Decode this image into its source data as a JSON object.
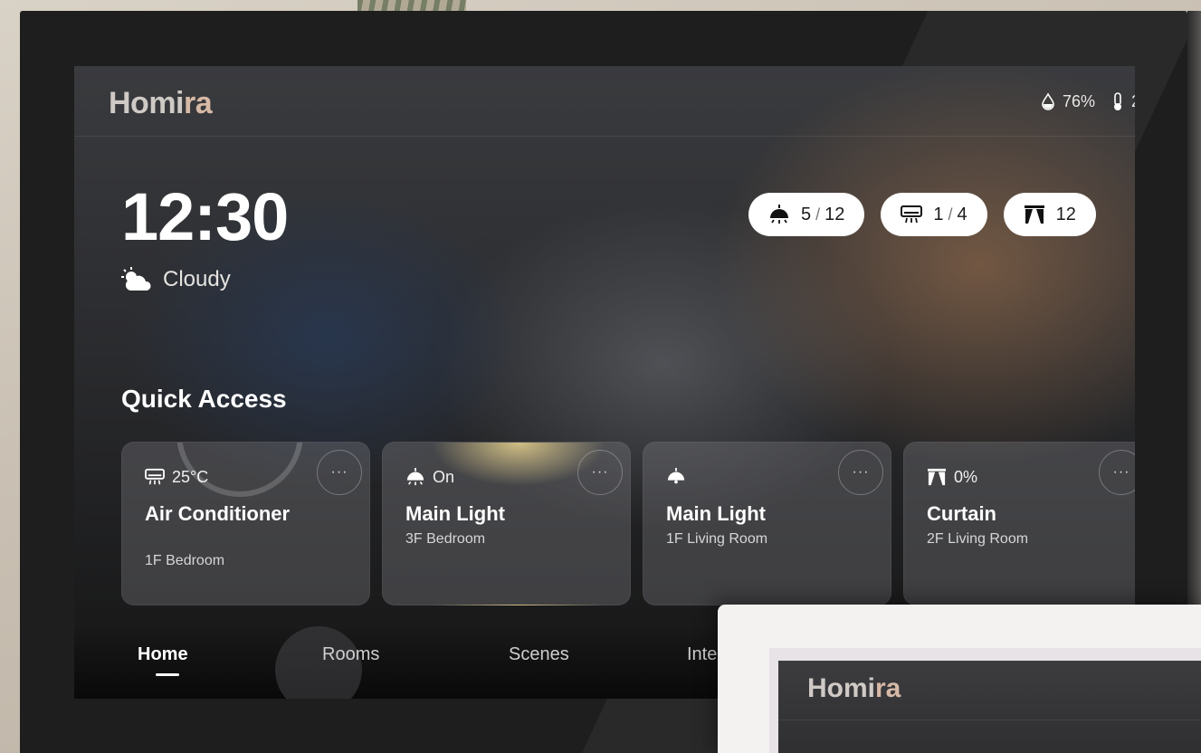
{
  "app": {
    "brand_main": "Homi",
    "brand_accent": "ra"
  },
  "status_bar": {
    "humidity": "76%",
    "temperature": "2"
  },
  "clock": {
    "time": "12:30",
    "weather": "Cloudy",
    "weather_icon": "partly-cloudy-icon"
  },
  "device_counts": [
    {
      "icon": "ceiling-light-icon",
      "on": "5",
      "total": "12"
    },
    {
      "icon": "air-conditioner-icon",
      "on": "1",
      "total": "4"
    },
    {
      "icon": "curtain-icon",
      "on": "12",
      "total": ""
    }
  ],
  "quick_access": {
    "title": "Quick Access",
    "cards": [
      {
        "icon": "air-conditioner-icon",
        "status": "25°C",
        "name": "Air Conditioner",
        "room": "1F Bedroom"
      },
      {
        "icon": "ceiling-light-icon",
        "status": "On",
        "name": "Main Light",
        "room": "3F Bedroom"
      },
      {
        "icon": "ceiling-light-icon",
        "status": "",
        "name": "Main Light",
        "room": "1F Living Room"
      },
      {
        "icon": "curtain-icon",
        "status": "0%",
        "name": "Curtain",
        "room": "2F Living Room"
      }
    ],
    "more_label": "···"
  },
  "nav": {
    "tabs": [
      "Home",
      "Rooms",
      "Scenes",
      "Inte"
    ],
    "active": "Home"
  },
  "second_device": {
    "brand_main": "Homi",
    "brand_accent": "ra"
  },
  "colors": {
    "accent": "#d7b9a6",
    "brand": "#cfcac5",
    "pill_bg": "#ffffff"
  }
}
